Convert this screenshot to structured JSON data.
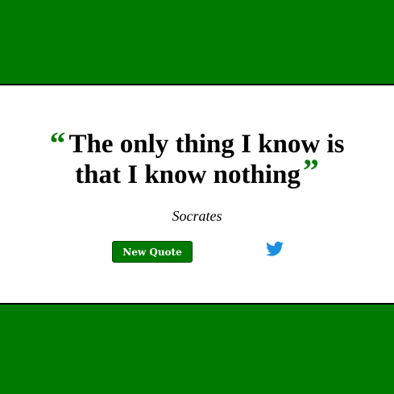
{
  "quote": {
    "text_line1": "The only thing I know is",
    "text_line2": "that I know nothing",
    "open_mark": "“",
    "close_mark": "”",
    "author": "Socrates"
  },
  "actions": {
    "new_quote_label": "New Quote",
    "tweet_icon": "twitter-bird-icon"
  },
  "colors": {
    "background": "#007a00",
    "card": "#ffffff",
    "accent": "#0b7a0b",
    "twitter": "#1d8fe0"
  }
}
